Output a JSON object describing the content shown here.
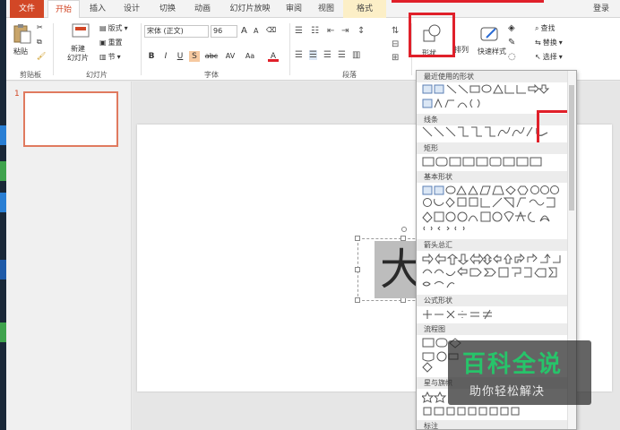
{
  "tabs": {
    "file": "文件",
    "home": "开始",
    "insert": "插入",
    "design": "设计",
    "transitions": "切换",
    "animations": "动画",
    "slideshow": "幻灯片放映",
    "review": "审阅",
    "view": "视图",
    "format": "格式",
    "login": "登录"
  },
  "clipboard": {
    "paste": "粘贴",
    "label": "剪贴板"
  },
  "slides": {
    "new_slide": "新建\n幻灯片",
    "layout": "版式",
    "reset": "重置",
    "section": "节",
    "label": "幻灯片"
  },
  "font": {
    "name": "宋体 (正文)",
    "size": "96",
    "label": "字体",
    "bold": "B",
    "italic": "I",
    "underline": "U",
    "shadow": "S",
    "strike": "abc",
    "spacing": "AV",
    "case": "Aa",
    "grow": "A",
    "shrink": "A",
    "color": "A"
  },
  "paragraph": {
    "label": "段落"
  },
  "drawing": {
    "shapes": "形状",
    "arrange": "排列",
    "quick_styles": "快速样式"
  },
  "editing": {
    "find": "查找",
    "replace": "替换",
    "select": "选择"
  },
  "thumbnail": {
    "number": "1"
  },
  "slide_text": "大",
  "gallery": {
    "recent": "最近使用的形状",
    "lines": "线条",
    "rectangles": "矩形",
    "basic": "基本形状",
    "arrows": "箭头总汇",
    "equation": "公式形状",
    "flowchart": "流程图",
    "stars": "星与旗帜",
    "callouts": "标注"
  },
  "watermark": {
    "title": "百科全说",
    "subtitle": "助你轻松解决"
  },
  "colors": {
    "accent": "#d24726",
    "highlight": "#e0202a",
    "watermark_green": "#27c46a"
  }
}
